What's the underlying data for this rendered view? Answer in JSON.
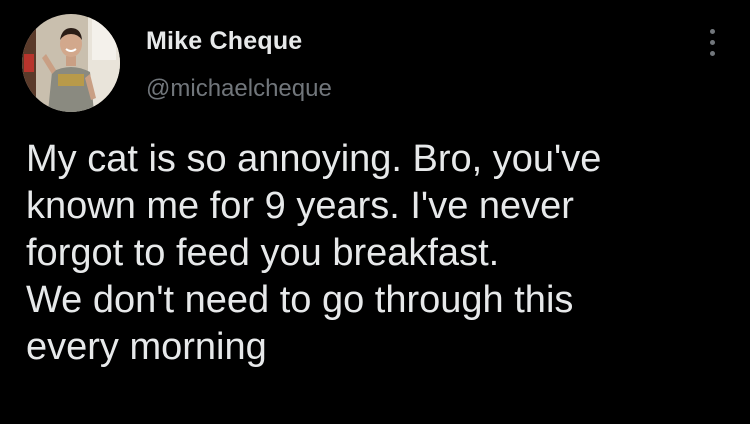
{
  "author": {
    "display_name": "Mike Cheque",
    "handle": "@michaelcheque"
  },
  "more_icon": "vertical-ellipsis-icon",
  "tweet": {
    "lines": [
      "My cat is so annoying. Bro, you've",
      "known me for 9 years. I've never",
      "forgot to feed you breakfast.",
      "We don't need to go through this",
      "every morning"
    ]
  },
  "colors": {
    "background": "#000000",
    "primary_text": "#e7e9ea",
    "secondary_text": "#71767b"
  }
}
